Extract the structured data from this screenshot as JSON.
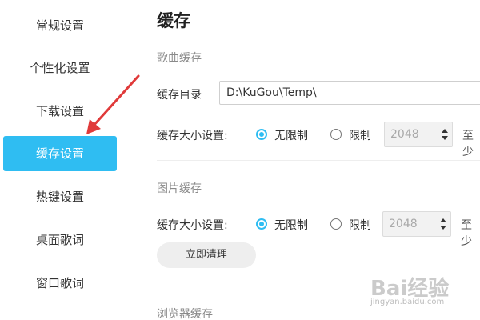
{
  "sidebar": {
    "items": [
      {
        "label": "常规设置"
      },
      {
        "label": "个性化设置"
      },
      {
        "label": "下载设置"
      },
      {
        "label": "缓存设置",
        "active": true
      },
      {
        "label": "热键设置"
      },
      {
        "label": "桌面歌词"
      },
      {
        "label": "窗口歌词"
      }
    ]
  },
  "main": {
    "title": "缓存",
    "song_cache": {
      "section_title": "歌曲缓存",
      "dir_label": "缓存目录",
      "dir_value": "D:\\KuGou\\Temp\\",
      "size_label": "缓存大小设置:",
      "unlimited_label": "无限制",
      "limit_label": "限制",
      "limit_value": "2048",
      "limit_suffix": "至少",
      "selected": "unlimited"
    },
    "image_cache": {
      "section_title": "图片缓存",
      "size_label": "缓存大小设置:",
      "unlimited_label": "无限制",
      "limit_label": "限制",
      "limit_value": "2048",
      "limit_suffix": "至少",
      "selected": "unlimited",
      "clear_button": "立即清理"
    },
    "browser_cache": {
      "section_title": "浏览器缓存"
    }
  },
  "watermark": {
    "logo": "Bai经验",
    "url": "jingyan.baidu.com"
  },
  "colors": {
    "accent": "#2fbdf2",
    "annotation_arrow": "#e03a3a"
  }
}
